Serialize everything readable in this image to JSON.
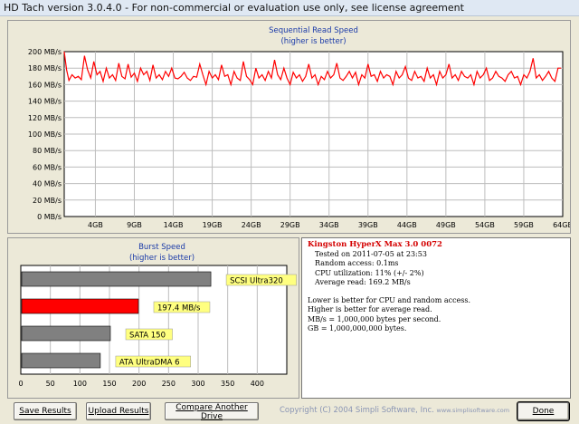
{
  "window": {
    "title": "HD Tach version 3.0.4.0  - For non-commercial or evaluation use only, see license agreement"
  },
  "sequential": {
    "title": "Sequential Read Speed",
    "subtitle": "(higher is better)"
  },
  "burst": {
    "title": "Burst Speed",
    "subtitle": "(higher is better)"
  },
  "info": {
    "drive_name": "Kingston HyperX Max 3.0 0072",
    "tested_on": "Tested on 2011-07-05 at 23:53",
    "random_access": "Random access: 0.1ms",
    "cpu_utilization": "CPU utilization: 11% (+/- 2%)",
    "average_read": "Average read: 169.2 MB/s",
    "notes": [
      "Lower is better for CPU and random access.",
      "Higher is better for average read.",
      "MB/s = 1,000,000 bytes per second.",
      "GB = 1,000,000,000 bytes."
    ]
  },
  "buttons": {
    "save": "Save Results",
    "upload": "Upload Results",
    "compare": "Compare Another Drive",
    "done": "Done"
  },
  "copyright": {
    "text": "Copyright (C) 2004 Simpli Software, Inc.",
    "url": "www.simplisoftware.com"
  },
  "chart_data": [
    {
      "type": "line",
      "title": "Sequential Read Speed",
      "subtitle": "(higher is better)",
      "xlabel": "",
      "ylabel": "",
      "ylim": [
        0,
        200
      ],
      "yticks": [
        "0 MB/s",
        "20 MB/s",
        "40 MB/s",
        "60 MB/s",
        "80 MB/s",
        "100 MB/s",
        "120 MB/s",
        "140 MB/s",
        "160 MB/s",
        "180 MB/s",
        "200 MB/s"
      ],
      "xlim": [
        0,
        64
      ],
      "xticks": [
        "4GB",
        "9GB",
        "14GB",
        "19GB",
        "24GB",
        "29GB",
        "34GB",
        "39GB",
        "44GB",
        "49GB",
        "54GB",
        "59GB",
        "64GB"
      ],
      "grid": true,
      "line_color": "#ff0000",
      "x": [
        0,
        0.3,
        0.6,
        1,
        1.4,
        1.8,
        2.2,
        2.6,
        3,
        3.4,
        3.8,
        4.2,
        4.6,
        5,
        5.4,
        5.8,
        6.2,
        6.6,
        7,
        7.4,
        7.8,
        8.2,
        8.6,
        9,
        9.4,
        9.8,
        10.2,
        10.6,
        11,
        11.4,
        11.8,
        12.2,
        12.6,
        13,
        13.4,
        13.8,
        14.2,
        14.6,
        15,
        15.4,
        15.8,
        16.2,
        16.6,
        17,
        17.4,
        17.8,
        18.2,
        18.6,
        19,
        19.4,
        19.8,
        20.2,
        20.6,
        21,
        21.4,
        21.8,
        22.2,
        22.6,
        23,
        23.4,
        23.8,
        24.2,
        24.6,
        25,
        25.4,
        25.8,
        26.2,
        26.6,
        27,
        27.4,
        27.8,
        28.2,
        28.6,
        29,
        29.4,
        29.8,
        30.2,
        30.6,
        31,
        31.4,
        31.8,
        32.2,
        32.6,
        33,
        33.4,
        33.8,
        34.2,
        34.6,
        35,
        35.4,
        35.8,
        36.2,
        36.6,
        37,
        37.4,
        37.8,
        38.2,
        38.6,
        39,
        39.4,
        39.8,
        40.2,
        40.6,
        41,
        41.4,
        41.8,
        42.2,
        42.6,
        43,
        43.4,
        43.8,
        44.2,
        44.6,
        45,
        45.4,
        45.8,
        46.2,
        46.6,
        47,
        47.4,
        47.8,
        48.2,
        48.6,
        49,
        49.4,
        49.8,
        50.2,
        50.6,
        51,
        51.4,
        51.8,
        52.2,
        52.6,
        53,
        53.4,
        53.8,
        54.2,
        54.6,
        55,
        55.4,
        55.8,
        56.2,
        56.6,
        57,
        57.4,
        57.8,
        58.2,
        58.6,
        59,
        59.4,
        59.8,
        60.2,
        60.6,
        61,
        61.4,
        61.8,
        62.2,
        62.6,
        63,
        63.4,
        63.8,
        64
      ],
      "y": [
        200,
        178,
        165,
        172,
        168,
        170,
        166,
        195,
        178,
        168,
        188,
        172,
        176,
        164,
        180,
        168,
        172,
        165,
        186,
        170,
        167,
        185,
        169,
        174,
        164,
        180,
        172,
        176,
        165,
        184,
        168,
        172,
        166,
        176,
        170,
        180,
        168,
        167,
        170,
        175,
        168,
        165,
        170,
        169,
        185,
        172,
        160,
        176,
        168,
        172,
        166,
        184,
        170,
        172,
        160,
        176,
        168,
        165,
        188,
        170,
        166,
        160,
        180,
        168,
        172,
        165,
        176,
        168,
        190,
        172,
        166,
        180,
        168,
        160,
        175,
        168,
        172,
        164,
        170,
        185,
        168,
        172,
        160,
        170,
        166,
        176,
        168,
        172,
        186,
        168,
        165,
        170,
        176,
        168,
        175,
        160,
        172,
        168,
        185,
        170,
        172,
        164,
        176,
        168,
        172,
        170,
        160,
        176,
        168,
        172,
        182,
        168,
        165,
        176,
        168,
        170,
        164,
        180,
        168,
        172,
        160,
        176,
        168,
        172,
        185,
        168,
        172,
        165,
        176,
        170,
        168,
        172,
        160,
        176,
        168,
        172,
        180,
        165,
        168,
        176,
        170,
        168,
        164,
        172,
        176,
        168,
        170,
        160,
        172,
        168,
        176,
        192,
        168,
        172,
        165,
        170,
        176,
        168,
        164,
        180,
        180
      ]
    },
    {
      "type": "bar",
      "orientation": "horizontal",
      "title": "Burst Speed",
      "subtitle": "(higher is better)",
      "xlim": [
        0,
        450
      ],
      "xticks": [
        "0",
        "50",
        "100",
        "150",
        "200",
        "250",
        "300",
        "350",
        "400"
      ],
      "xtick_values": [
        0,
        50,
        100,
        150,
        200,
        250,
        300,
        350,
        400
      ],
      "bars": [
        {
          "label": "SCSI Ultra320",
          "value": 320,
          "color": "#808080"
        },
        {
          "label": "197.4 MB/s",
          "value": 197.4,
          "color": "#ff0000"
        },
        {
          "label": "SATA 150",
          "value": 150,
          "color": "#808080"
        },
        {
          "label": "ATA UltraDMA 6",
          "value": 133,
          "color": "#808080"
        }
      ],
      "label_color": "#ffff80"
    }
  ]
}
